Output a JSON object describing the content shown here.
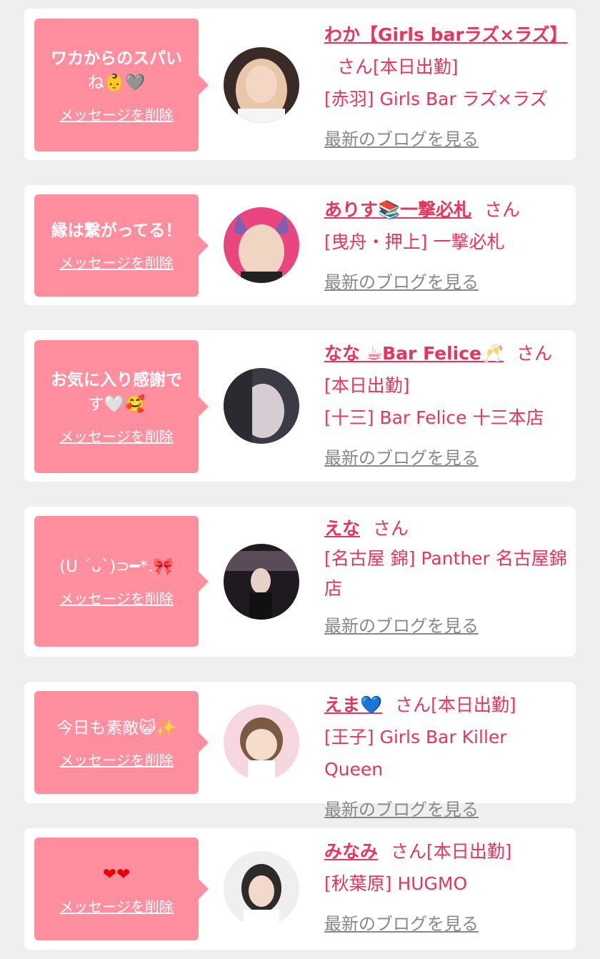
{
  "common": {
    "delete_label": "メッセージを削除",
    "blog_label": "最新のブログを見る",
    "san": "さん"
  },
  "cards": [
    {
      "message_line1": "ワカからのスパい",
      "message_line2": "ね👶🩶",
      "name": "わか【Girls barラズ×ラズ】",
      "status": "[本日出勤]",
      "shop": "[赤羽] Girls Bar ラズ×ラズ"
    },
    {
      "message_line1": "縁は繋がってる！",
      "name": "ありす📚一撃必札",
      "shop": "[曳舟・押上] 一撃必札"
    },
    {
      "message_line1": "お気に入り感謝で",
      "message_line2": "す🤍🥰",
      "name": "なな ☕Bar Felice🥂",
      "status": "[本日出勤]",
      "shop": "[十三] Bar Felice 十三本店"
    },
    {
      "message_line1": "(U ´ᴗ`)⊃━*.🎀",
      "name": "えな",
      "shop": "[名古屋 錦] Panther 名古屋錦店"
    },
    {
      "message_line1": "今日も素敵😺✨",
      "name": "えま💙",
      "status": "[本日出勤]",
      "shop": "[王子] Girls Bar Killer Queen"
    },
    {
      "message_line1": "❤❤",
      "name": "みなみ",
      "status": "[本日出勤]",
      "shop": "[秋葉原] HUGMO"
    }
  ]
}
